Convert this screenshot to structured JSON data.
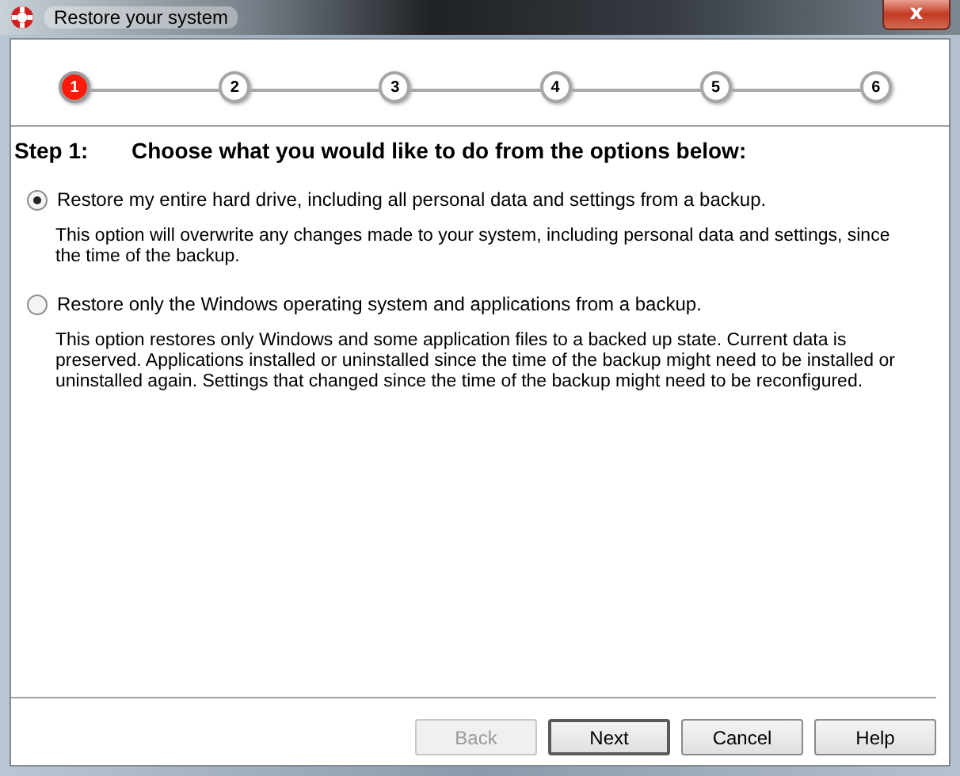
{
  "window": {
    "title": "Restore your system",
    "close": "x"
  },
  "steps": [
    {
      "label": "1",
      "selected": true
    },
    {
      "label": "2",
      "selected": false
    },
    {
      "label": "3",
      "selected": false
    },
    {
      "label": "4",
      "selected": false
    },
    {
      "label": "5",
      "selected": false
    },
    {
      "label": "6",
      "selected": false
    }
  ],
  "step_label": "Step 1:",
  "heading": "Choose what you would like to do from the options below:",
  "options": [
    {
      "label": "Restore my entire hard drive, including all personal data and settings from a backup.",
      "description": "This option will overwrite any changes made to your system, including personal data and settings, since the time of the backup.",
      "selected": true
    },
    {
      "label": "Restore only the Windows operating system and applications from a backup.",
      "description": "This option restores only Windows and some application files to a backed up state. Current data is preserved. Applications installed or uninstalled since the time of the backup might need to be installed or uninstalled again. Settings that changed since the time of the backup might need to be reconfigured.",
      "selected": false
    }
  ],
  "buttons": [
    {
      "label": "Back",
      "disabled": true,
      "default": false
    },
    {
      "label": "Next",
      "disabled": false,
      "default": true
    },
    {
      "label": "Cancel",
      "disabled": false,
      "default": false
    },
    {
      "label": "Help",
      "disabled": false,
      "default": false
    }
  ]
}
